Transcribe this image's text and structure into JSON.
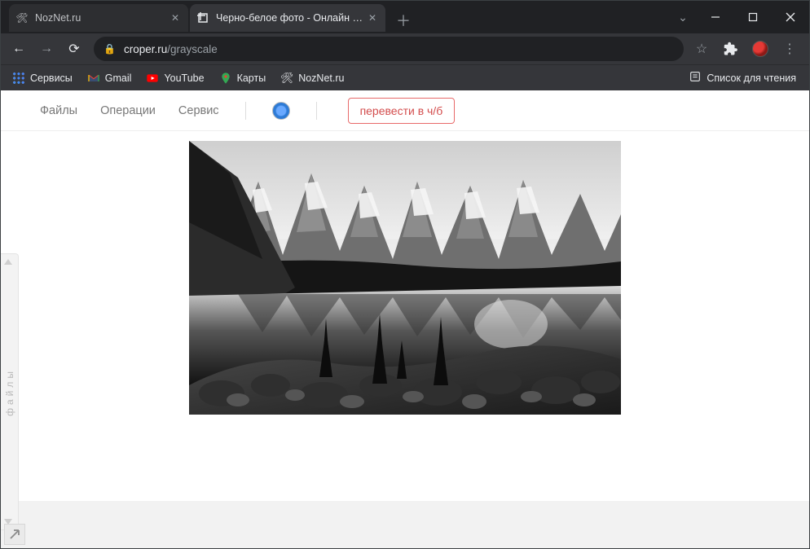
{
  "tabs": [
    {
      "title": "NozNet.ru",
      "favicon": "🛠"
    },
    {
      "title": "Черно-белое фото - Онлайн фо",
      "favicon": "crop"
    }
  ],
  "address": {
    "host": "croper.ru",
    "path": "/grayscale"
  },
  "bookmarks": {
    "apps": "Сервисы",
    "gmail": "Gmail",
    "youtube": "YouTube",
    "maps": "Карты",
    "noznet": "NozNet.ru",
    "reading_list": "Список для чтения"
  },
  "app_menu": {
    "files": "Файлы",
    "operations": "Операции",
    "service": "Сервис",
    "convert_btn": "перевести в ч/б"
  },
  "side_panel_label": "файлы"
}
